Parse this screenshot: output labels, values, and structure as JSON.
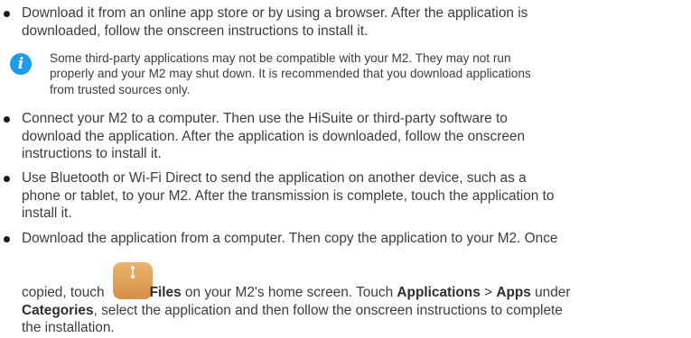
{
  "bullets": [
    {
      "text_1": "Download it from an online app store or by using a browser. After the application is",
      "text_2": "downloaded, follow the onscreen instructions to install it."
    },
    {
      "text_1": "Connect your M2 to a computer. Then use the HiSuite or third-party software to",
      "text_2": "download the application. After the application is downloaded, follow the onscreen",
      "text_3": "instructions to install it."
    },
    {
      "text_1": "Use Bluetooth or Wi-Fi Direct to send the application on another device, such as a",
      "text_2": "phone or tablet, to your M2. After the transmission is complete, touch the application to",
      "text_3": "install it."
    },
    {
      "text_1": "Download the application from a computer. Then copy the application to your M2. Once",
      "copied_touch": "copied, touch",
      "files_label": "Files",
      "after_files": "on your M2's home screen. Touch",
      "applications_label": "Applications",
      "separator": ">",
      "apps_label": "Apps",
      "under": "under",
      "categories_label": "Categories",
      "rest_1": ", select the application and then follow the onscreen instructions to complete",
      "rest_2": "the installation."
    }
  ],
  "note": {
    "icon": "info-icon",
    "line_1": "Some third-party applications may not be compatible with your M2. They may not run",
    "line_2": "properly and your M2 may shut down. It is recommended that you download applications",
    "line_3": "from trusted sources only."
  },
  "colors": {
    "info_icon": "#1e9be9",
    "files_icon": "#e0a15a",
    "text": "#3c3c3c"
  }
}
